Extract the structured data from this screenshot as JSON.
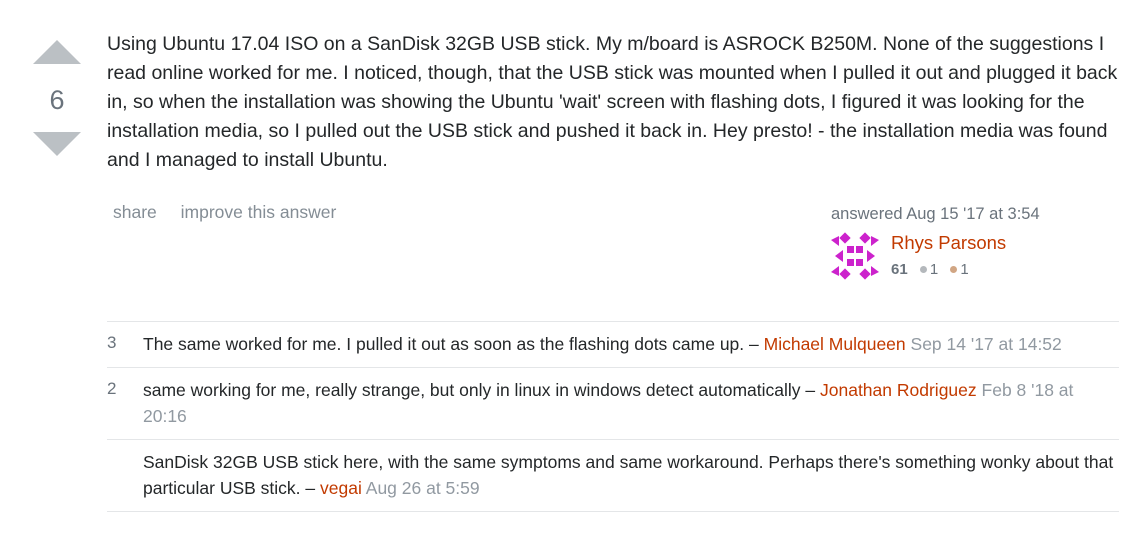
{
  "vote": {
    "count": "6",
    "up_label": "vote up",
    "down_label": "vote down"
  },
  "answer": {
    "text": "Using Ubuntu 17.04 ISO on a SanDisk 32GB USB stick. My m/board is ASROCK B250M. None of the suggestions I read online worked for me. I noticed, though, that the USB stick was mounted when I pulled it out and plugged it back in, so when the installation was showing the Ubuntu 'wait' screen with flashing dots, I figured it was looking for the installation media, so I pulled out the USB stick and pushed it back in. Hey presto! - the installation media was found and I managed to install Ubuntu."
  },
  "menu": {
    "share": "share",
    "improve": "improve this answer"
  },
  "author": {
    "action": "answered Aug 15 '17 at 3:54",
    "name": "Rhys Parsons",
    "reputation": "61",
    "silver_badges": "1",
    "bronze_badges": "1",
    "silver_color": "#b4b8bc",
    "bronze_color": "#d1a684",
    "avatar_color": "#cc22cc"
  },
  "comments": [
    {
      "score": "3",
      "text": "The same worked for me. I pulled it out as soon as the flashing dots came up. –",
      "user": "Michael Mulqueen",
      "date": "Sep 14 '17 at 14:52"
    },
    {
      "score": "2",
      "text": "same working for me, really strange, but only in linux in windows detect automatically –",
      "user": "Jonathan Rodriguez",
      "date": "Feb 8 '18 at 20:16"
    },
    {
      "score": "",
      "text": "SanDisk 32GB USB stick here, with the same symptoms and same workaround. Perhaps there's something wonky about that particular USB stick. –",
      "user": "vegai",
      "date": "Aug 26 at 5:59"
    }
  ]
}
